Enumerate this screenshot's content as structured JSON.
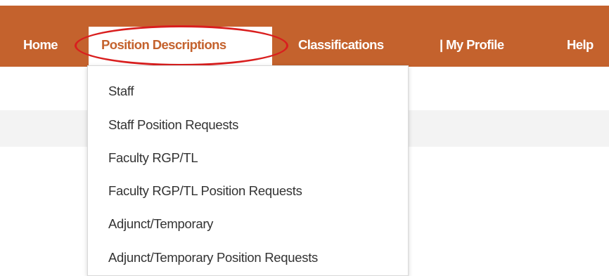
{
  "nav": {
    "color": "#c4622d",
    "items": [
      {
        "label": "Home"
      },
      {
        "label": "Position Descriptions",
        "active": true
      },
      {
        "label": "Classifications"
      },
      {
        "label": "| My Profile"
      },
      {
        "label": "Help"
      }
    ]
  },
  "dropdown": {
    "items": [
      {
        "label": "Staff"
      },
      {
        "label": "Staff Position Requests"
      },
      {
        "label": "Faculty RGP/TL"
      },
      {
        "label": "Faculty RGP/TL Position Requests"
      },
      {
        "label": "Adjunct/Temporary"
      },
      {
        "label": "Adjunct/Temporary Position Requests"
      }
    ]
  },
  "annotation": {
    "color": "#d91e1e",
    "shape": "ellipse",
    "target": "Position Descriptions"
  }
}
